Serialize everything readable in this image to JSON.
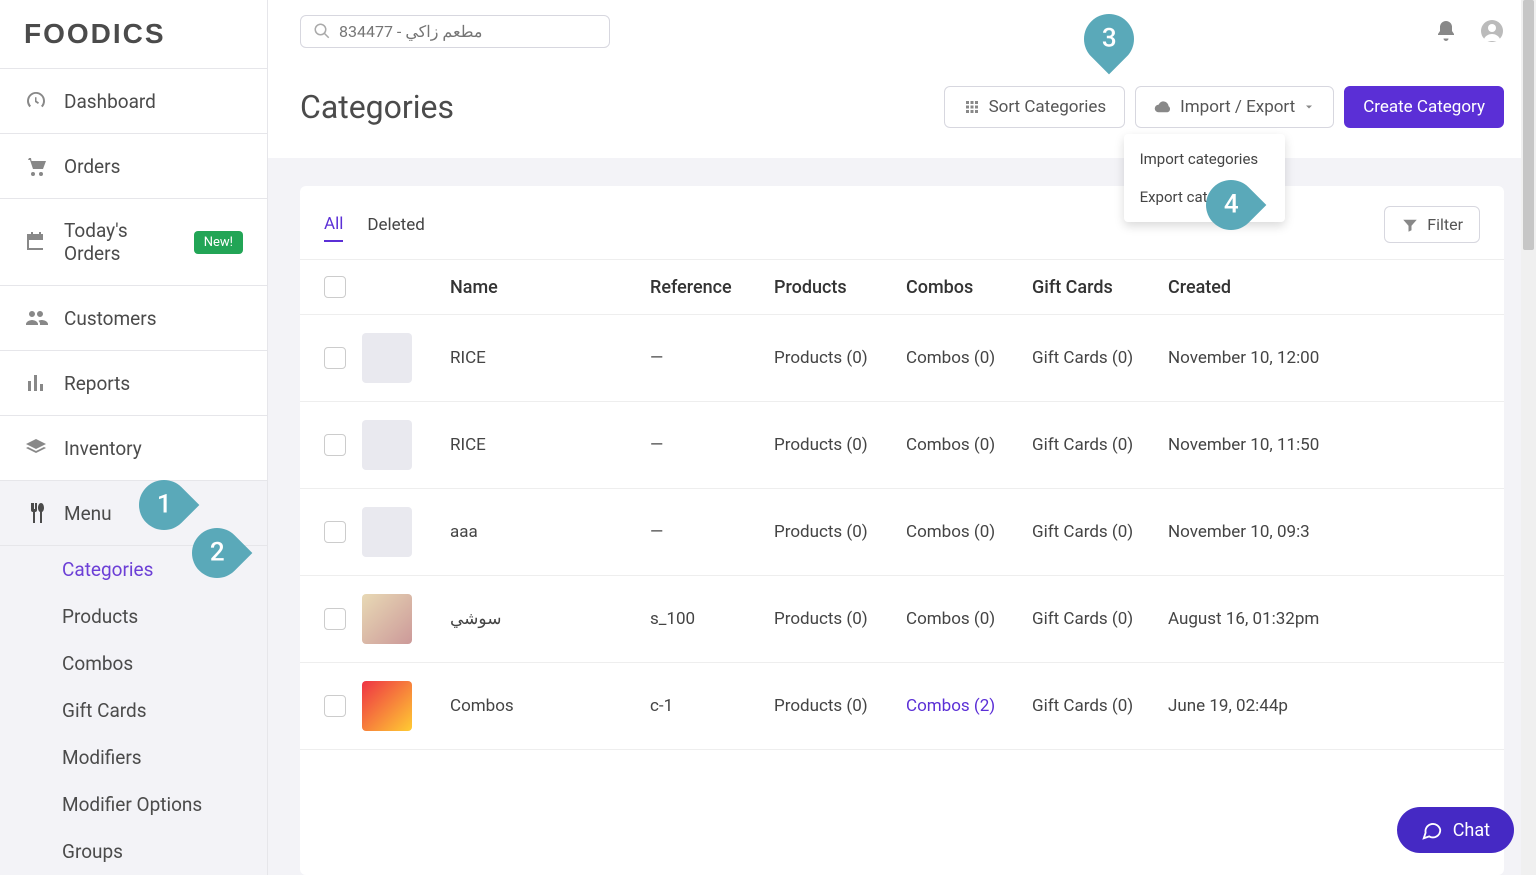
{
  "brand": "FOODICS",
  "search": {
    "placeholder": "834477 - مطعم زاكي"
  },
  "sidebar": {
    "items": [
      {
        "label": "Dashboard",
        "icon": "gauge"
      },
      {
        "label": "Orders",
        "icon": "cart"
      },
      {
        "label": "Today's Orders",
        "icon": "calendar",
        "badge": "New!"
      },
      {
        "label": "Customers",
        "icon": "users"
      },
      {
        "label": "Reports",
        "icon": "bars"
      },
      {
        "label": "Inventory",
        "icon": "layers"
      },
      {
        "label": "Menu",
        "icon": "utensils",
        "active": true
      }
    ],
    "submenu": [
      {
        "label": "Categories",
        "selected": true
      },
      {
        "label": "Products"
      },
      {
        "label": "Combos"
      },
      {
        "label": "Gift Cards"
      },
      {
        "label": "Modifiers"
      },
      {
        "label": "Modifier Options"
      },
      {
        "label": "Groups"
      }
    ]
  },
  "page": {
    "title": "Categories",
    "actions": {
      "sort": "Sort Categories",
      "import_export": "Import / Export",
      "create": "Create Category"
    },
    "dropdown": {
      "import": "Import categories",
      "export": "Export categories"
    }
  },
  "tabs": {
    "all": "All",
    "deleted": "Deleted",
    "filter": "Filter"
  },
  "table": {
    "headers": {
      "name": "Name",
      "reference": "Reference",
      "products": "Products",
      "combos": "Combos",
      "giftcards": "Gift Cards",
      "created": "Created"
    },
    "rows": [
      {
        "name": "RICE",
        "reference": "—",
        "products": "Products (0)",
        "combos": "Combos (0)",
        "gift": "Gift Cards (0)",
        "created": "November 10, 12:00",
        "thumb": "blank"
      },
      {
        "name": "RICE",
        "reference": "—",
        "products": "Products (0)",
        "combos": "Combos (0)",
        "gift": "Gift Cards (0)",
        "created": "November 10, 11:50",
        "thumb": "blank"
      },
      {
        "name": "aaa",
        "reference": "—",
        "products": "Products (0)",
        "combos": "Combos (0)",
        "gift": "Gift Cards (0)",
        "created": "November 10, 09:3",
        "thumb": "blank"
      },
      {
        "name": "سوشي",
        "reference": "s_100",
        "products": "Products (0)",
        "combos": "Combos (0)",
        "gift": "Gift Cards (0)",
        "created": "August 16, 01:32pm",
        "thumb": "sushi"
      },
      {
        "name": "Combos",
        "reference": "c-1",
        "products": "Products (0)",
        "combos": "Combos (2)",
        "gift": "Gift Cards (0)",
        "created": "June 19, 02:44p",
        "thumb": "combo",
        "combo_link": true
      }
    ]
  },
  "callouts": {
    "c1": "1",
    "c2": "2",
    "c3": "3",
    "c4": "4"
  },
  "chat": {
    "label": "Chat"
  }
}
